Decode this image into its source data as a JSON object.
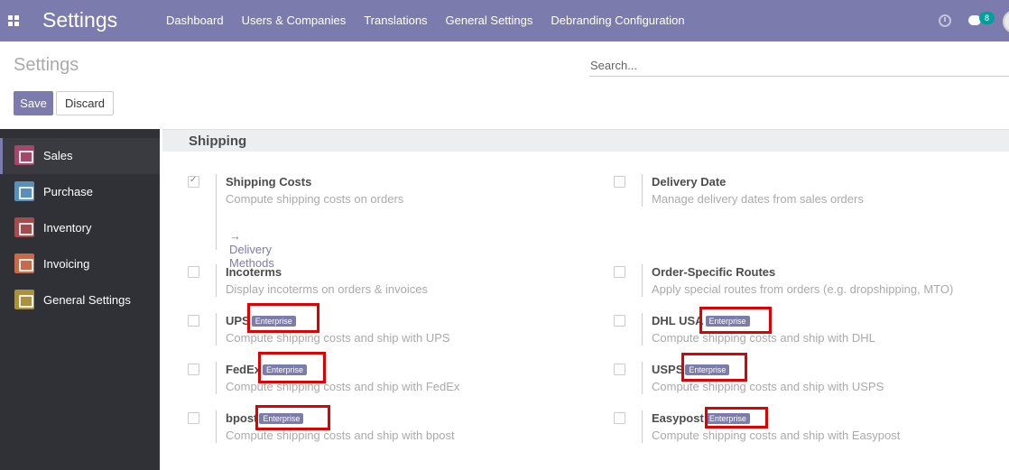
{
  "navbar": {
    "app_title": "Settings",
    "menu": [
      "Dashboard",
      "Users & Companies",
      "Translations",
      "General Settings",
      "Debranding Configuration"
    ],
    "chat_count": "8",
    "brand_color": "#7c7bad"
  },
  "control_panel": {
    "breadcrumb": "Settings",
    "search_placeholder": "Search...",
    "save_label": "Save",
    "discard_label": "Discard"
  },
  "sidebar": {
    "items": [
      {
        "label": "Sales",
        "icon": "sales-icon",
        "color": "#a2496b"
      },
      {
        "label": "Purchase",
        "icon": "purchase-icon",
        "color": "#5b8fb7"
      },
      {
        "label": "Inventory",
        "icon": "inventory-icon",
        "color": "#a24d4d"
      },
      {
        "label": "Invoicing",
        "icon": "invoicing-icon",
        "color": "#c56a4a"
      },
      {
        "label": "General Settings",
        "icon": "gear-icon",
        "color": "#a8923f"
      }
    ]
  },
  "section": {
    "title": "Shipping",
    "settings": [
      {
        "title": "Shipping Costs",
        "desc": "Compute shipping costs on orders",
        "checked": true,
        "link": "Delivery Methods"
      },
      {
        "title": "Delivery Date",
        "desc": "Manage delivery dates from sales orders",
        "checked": false
      },
      {
        "title": "Incoterms",
        "desc": "Display incoterms on orders & invoices",
        "checked": false
      },
      {
        "title": "Order-Specific Routes",
        "desc": "Apply special routes from orders (e.g. dropshipping, MTO)",
        "checked": false
      },
      {
        "title": "UPS",
        "desc": "Compute shipping costs and ship with UPS",
        "checked": false,
        "badge": "Enterprise"
      },
      {
        "title": "DHL USA",
        "desc": "Compute shipping costs and ship with DHL",
        "checked": false,
        "badge": "Enterprise"
      },
      {
        "title": "FedEx",
        "desc": "Compute shipping costs and ship with FedEx",
        "checked": false,
        "badge": "Enterprise"
      },
      {
        "title": "USPS",
        "desc": "Compute shipping costs and ship with USPS",
        "checked": false,
        "badge": "Enterprise"
      },
      {
        "title": "bpost",
        "desc": "Compute shipping costs and ship with bpost",
        "checked": false,
        "badge": "Enterprise"
      },
      {
        "title": "Easypost",
        "desc": "Compute shipping costs and ship with Easypost",
        "checked": false,
        "badge": "Enterprise"
      }
    ]
  },
  "highlight_color": "#e00000"
}
